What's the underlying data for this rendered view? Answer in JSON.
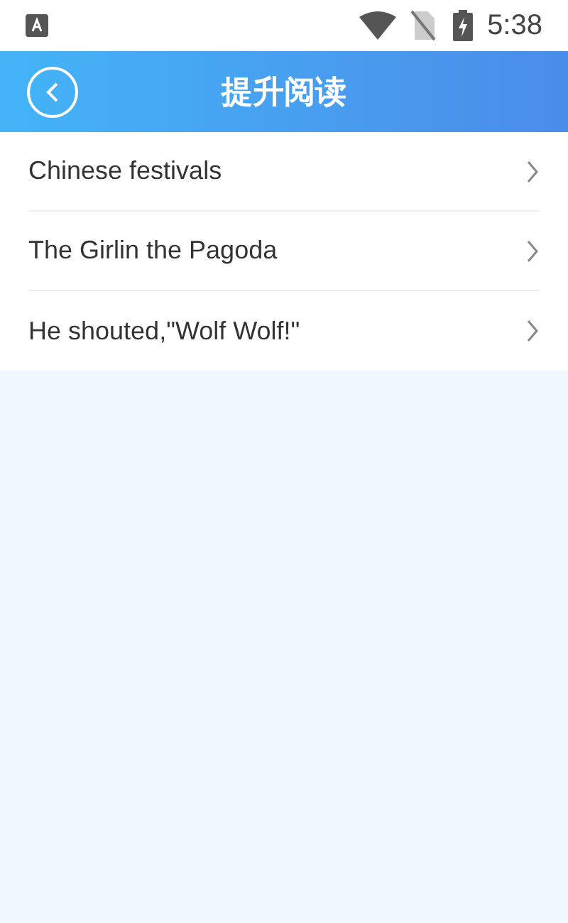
{
  "status_bar": {
    "time": "5:38"
  },
  "header": {
    "title": "提升阅读"
  },
  "items": [
    {
      "label": "Chinese festivals"
    },
    {
      "label": "The Girlin the Pagoda"
    },
    {
      "label": "He shouted,\"Wolf Wolf!\""
    }
  ]
}
